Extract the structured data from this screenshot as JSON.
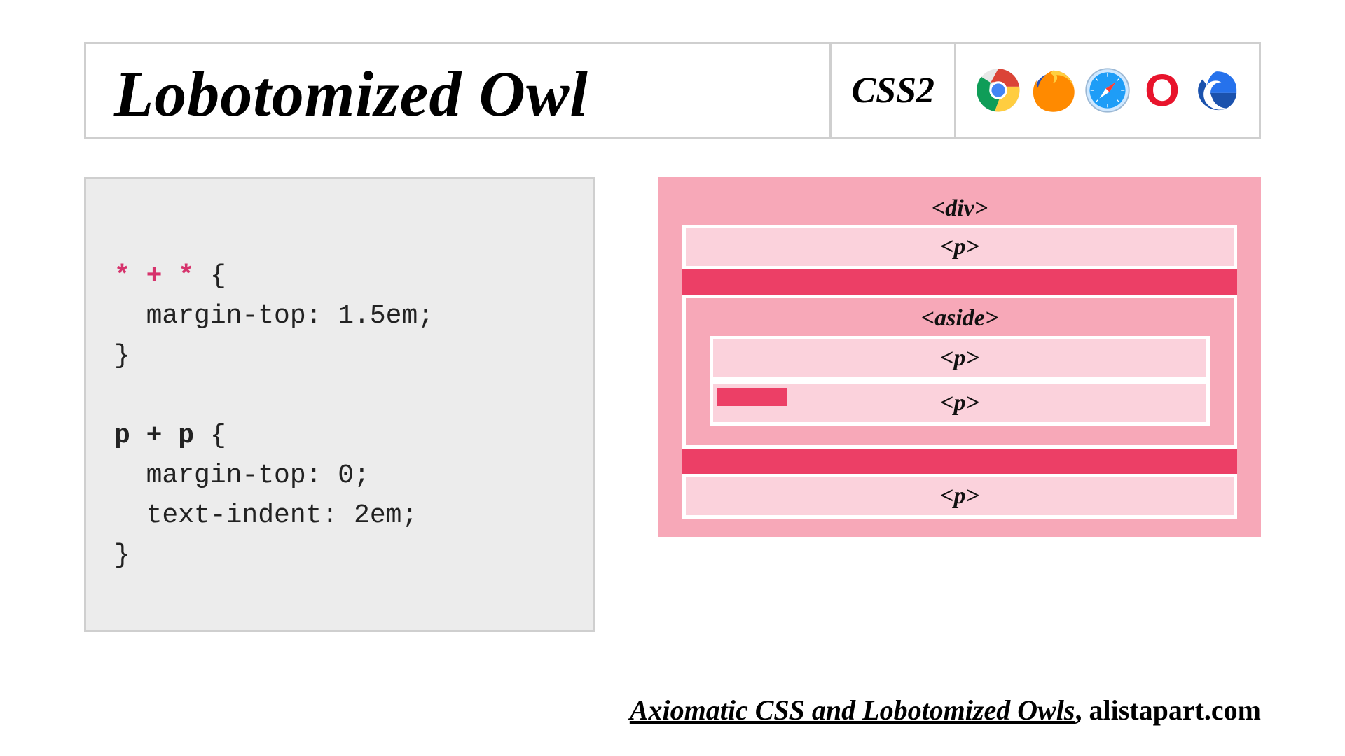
{
  "header": {
    "title": "Lobotomized Owl",
    "css_badge": "CSS2",
    "browsers": [
      "chrome",
      "firefox",
      "safari",
      "opera",
      "edge"
    ]
  },
  "code": {
    "rule1_selector": "* + *",
    "rule1_body1": "margin-top: 1.5em;",
    "rule2_selector": "p + p",
    "rule2_body1": "margin-top: 0;",
    "rule2_body2": "text-indent: 2em;",
    "brace_open": "{",
    "brace_close": "}"
  },
  "diagram": {
    "div_label": "<div>",
    "p_label": "<p>",
    "aside_label": "<aside>"
  },
  "footer": {
    "article_title": "Axiomatic CSS and Lobotomized Owls",
    "separator": ", ",
    "site": "alistapart.com"
  }
}
